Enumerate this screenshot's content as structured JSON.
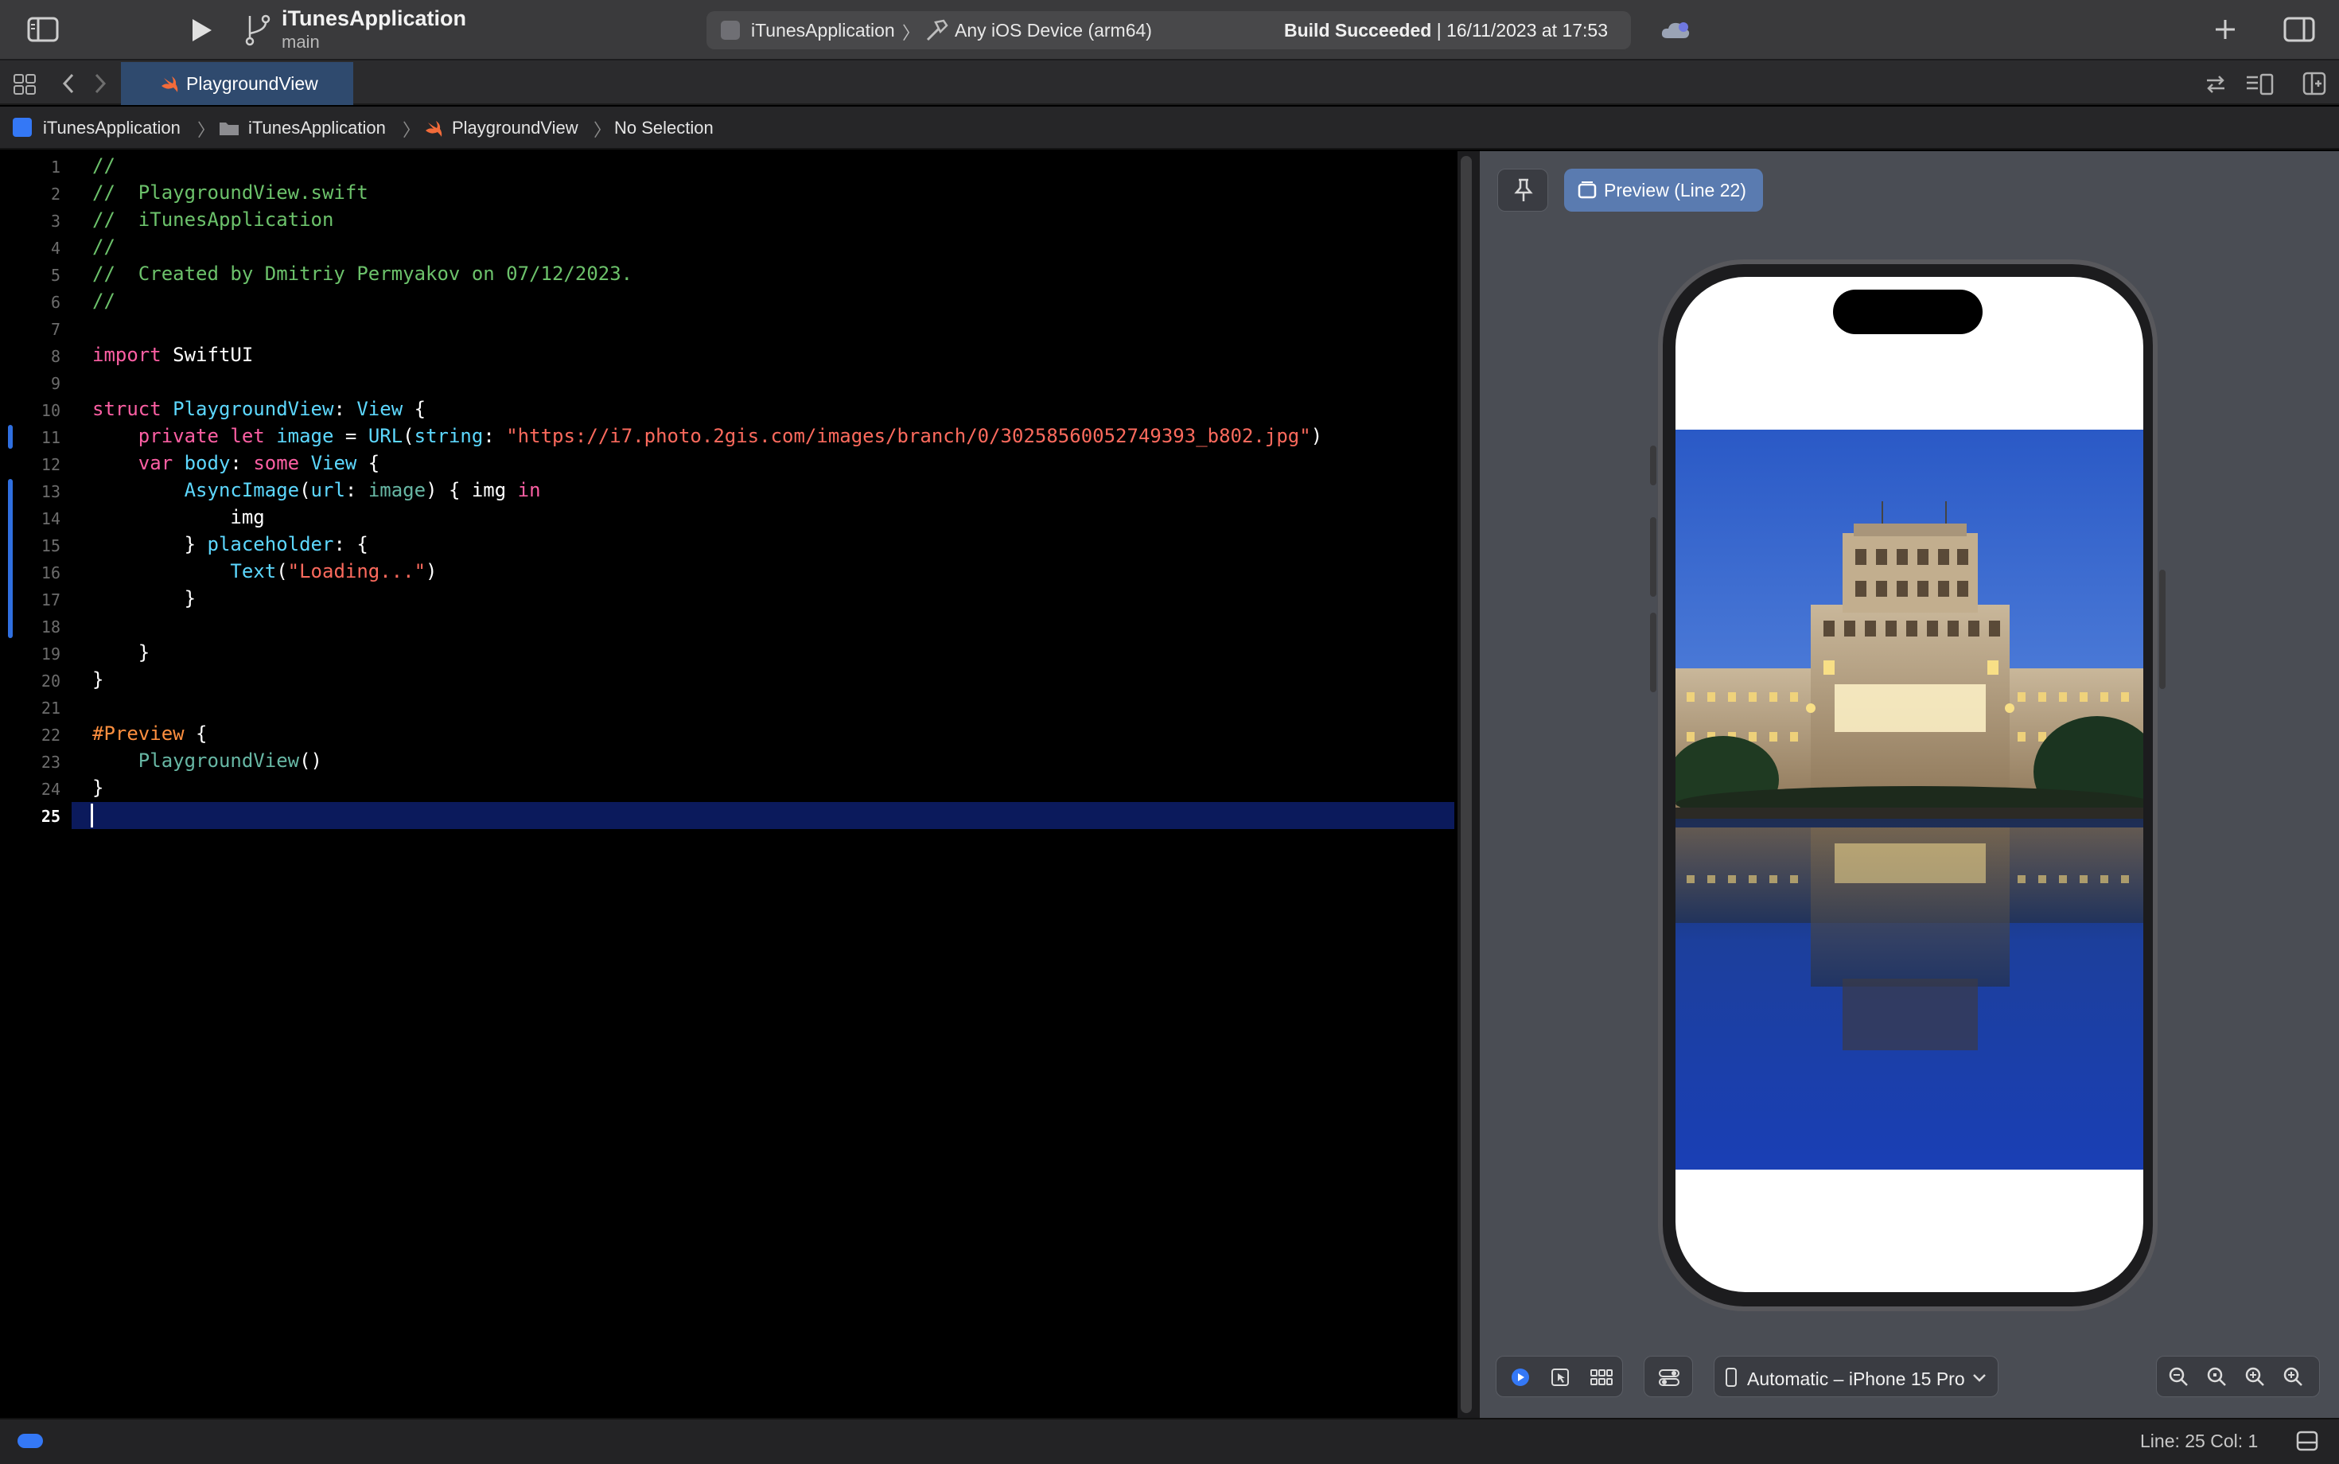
{
  "toolbar": {
    "project_title": "iTunesApplication",
    "branch": "main",
    "scheme": "iTunesApplication",
    "scheme_separator": "〉",
    "device": "Any iOS Device (arm64)",
    "build_status_bold": "Build Succeeded",
    "build_status_rest": " | 16/11/2023 at 17:53",
    "icons": [
      "sidebar-toggle-icon",
      "run-icon",
      "branch-icon",
      "scheme-app-icon",
      "hammer-icon",
      "cloud-icon",
      "plus-icon",
      "inspector-toggle-icon"
    ]
  },
  "tabbar": {
    "active_tab": "PlaygroundView",
    "icons": [
      "grid-icon",
      "back-chevron-icon",
      "forward-chevron-icon",
      "swift-file-icon",
      "swap-icon",
      "editor-options-icon",
      "add-editor-icon"
    ]
  },
  "breadcrumb": {
    "items": [
      "iTunesApplication",
      "iTunesApplication",
      "PlaygroundView",
      "No Selection"
    ],
    "separator": "〉"
  },
  "editor": {
    "line_numbers": [
      "1",
      "2",
      "3",
      "4",
      "5",
      "6",
      "7",
      "8",
      "9",
      "10",
      "11",
      "12",
      "13",
      "14",
      "15",
      "16",
      "17",
      "18",
      "19",
      "20",
      "21",
      "22",
      "23",
      "24",
      "25"
    ],
    "current_line": "25",
    "lines": {
      "l1": "//",
      "l2": "//  PlaygroundView.swift",
      "l3": "//  iTunesApplication",
      "l4": "//",
      "l5": "//  Created by Dmitriy Permyakov on 07/12/2023.",
      "l6": "//",
      "l8_kw": "import",
      "l8_rest": " SwiftUI",
      "l10_kw": "struct",
      "l10_name": " PlaygroundView",
      "l10_colon": ": ",
      "l10_type": "View",
      "l10_brace": " {",
      "l11_indent": "    ",
      "l11_kw": "private let",
      "l11_sp": " ",
      "l11_name": "image",
      "l11_eq": " = ",
      "l11_type": "URL",
      "l11_open": "(",
      "l11_param": "string",
      "l11_colon": ": ",
      "l11_str": "\"https://i7.photo.2gis.com/images/branch/0/30258560052749393_b802.jpg\"",
      "l11_close": ")",
      "l12_indent": "    ",
      "l12_kw": "var",
      "l12_sp": " ",
      "l12_name": "body",
      "l12_colon": ": ",
      "l12_kw2": "some",
      "l12_sp2": " ",
      "l12_type": "View",
      "l12_brace": " {",
      "l13_indent": "        ",
      "l13_type": "AsyncImage",
      "l13_open": "(",
      "l13_param": "url",
      "l13_colon": ": ",
      "l13_arg": "image",
      "l13_rest": ") { img ",
      "l13_kw": "in",
      "l14": "            img",
      "l15_pre": "        } ",
      "l15_param": "placeholder",
      "l15_rest": ": {",
      "l16_indent": "            ",
      "l16_type": "Text",
      "l16_open": "(",
      "l16_str": "\"Loading...\"",
      "l16_close": ")",
      "l17": "        }",
      "l19": "    }",
      "l20": "}",
      "l22_pre": "#Preview",
      "l22_rest": " {",
      "l23_indent": "    ",
      "l23_fn": "PlaygroundView",
      "l23_rest": "()",
      "l24": "}"
    }
  },
  "canvas": {
    "preview_label": "Preview (Line 22)",
    "device_selector": "Automatic – iPhone 15 Pro",
    "icons": [
      "pin-icon",
      "preview-icon",
      "live-mode-icon",
      "selectable-mode-icon",
      "variants-icon",
      "device-settings-icon",
      "device-icon",
      "chevron-down-icon",
      "zoom-out-icon",
      "zoom-in-icon",
      "zoom-fit-icon",
      "zoom-actual-icon"
    ]
  },
  "statusbar": {
    "line_col": "Line: 25  Col: 1"
  },
  "colors": {
    "accent": "#3478f6",
    "comment": "#6cc26b",
    "keyword": "#fc5fa3",
    "string": "#fc6a5d",
    "type": "#5dd8ff",
    "current_line": "#0b1a5c"
  }
}
